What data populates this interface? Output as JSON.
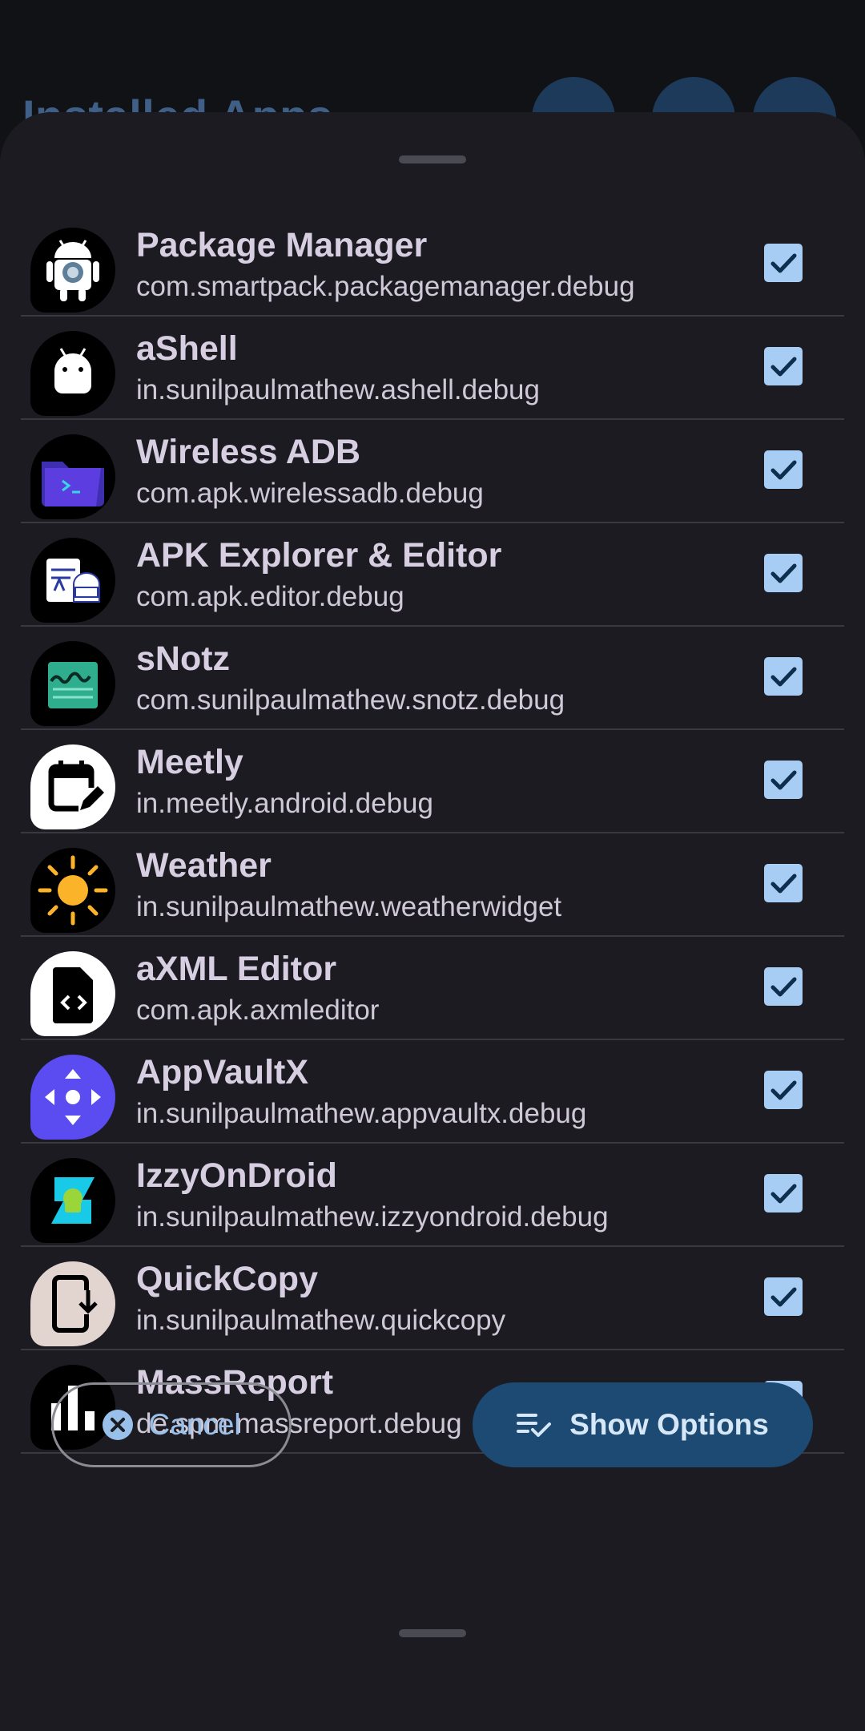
{
  "background": {
    "title": "Installed Apps"
  },
  "apps": [
    {
      "name": "Package Manager",
      "package": "com.smartpack.packagemanager.debug",
      "icon": "android-robot-icon",
      "checked": true
    },
    {
      "name": "aShell",
      "package": "in.sunilpaulmathew.ashell.debug",
      "icon": "android-head-icon",
      "checked": true
    },
    {
      "name": "Wireless ADB",
      "package": "com.apk.wirelessadb.debug",
      "icon": "terminal-folder-icon",
      "checked": true
    },
    {
      "name": "APK Explorer & Editor",
      "package": "com.apk.editor.debug",
      "icon": "apk-editor-icon",
      "checked": true
    },
    {
      "name": "sNotz",
      "package": "com.sunilpaulmathew.snotz.debug",
      "icon": "snotz-note-icon",
      "checked": true
    },
    {
      "name": "Meetly",
      "package": "in.meetly.android.debug",
      "icon": "calendar-edit-icon",
      "checked": true
    },
    {
      "name": "Weather",
      "package": "in.sunilpaulmathew.weatherwidget",
      "icon": "sun-icon",
      "checked": true
    },
    {
      "name": "aXML Editor",
      "package": "com.apk.axmleditor",
      "icon": "code-file-icon",
      "checked": true
    },
    {
      "name": "AppVaultX",
      "package": "in.sunilpaulmathew.appvaultx.debug",
      "icon": "vault-arrows-icon",
      "checked": true
    },
    {
      "name": "IzzyOnDroid",
      "package": "in.sunilpaulmathew.izzyondroid.debug",
      "icon": "izzy-droid-icon",
      "checked": true
    },
    {
      "name": "QuickCopy",
      "package": "in.sunilpaulmathew.quickcopy",
      "icon": "phone-download-icon",
      "checked": true
    },
    {
      "name": "MassReport",
      "package": "de.spm.massreport.debug",
      "icon": "bar-chart-icon",
      "checked": true
    }
  ],
  "actions": {
    "cancel_label": "Cancel",
    "show_options_label": "Show Options"
  },
  "colors": {
    "sheet": "#1c1b22",
    "checkbox": "#a8cdf4",
    "primary_button": "#1c4a73",
    "accent_text": "#98c0ea"
  }
}
